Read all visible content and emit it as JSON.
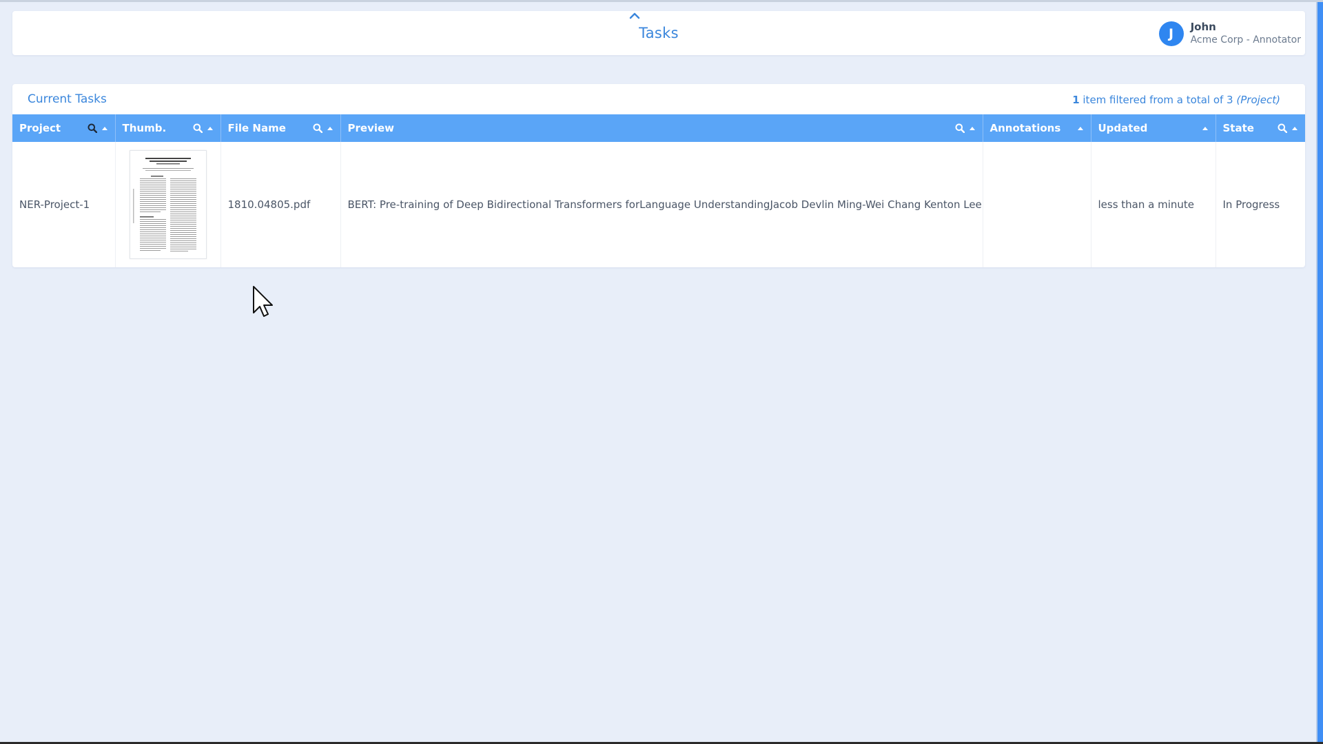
{
  "header": {
    "title": "Tasks",
    "user": {
      "initial": "J",
      "name": "John",
      "org": "Acme Corp - Annotator"
    }
  },
  "panel": {
    "title": "Current Tasks",
    "filter_count": "1",
    "filter_text": " item filtered from a total of 3 ",
    "filter_scope": "(Project)"
  },
  "table": {
    "columns": [
      {
        "label": "Project",
        "search": true,
        "sort": true
      },
      {
        "label": "Thumb.",
        "search": true,
        "sort": true
      },
      {
        "label": "File Name",
        "search": true,
        "sort": true
      },
      {
        "label": "Preview",
        "search": true,
        "sort": true
      },
      {
        "label": "Annotations",
        "search": false,
        "sort": true
      },
      {
        "label": "Updated",
        "search": false,
        "sort": true
      },
      {
        "label": "State",
        "search": true,
        "sort": true
      }
    ],
    "rows": [
      {
        "project": "NER-Project-1",
        "file_name": "1810.04805.pdf",
        "preview": "BERT: Pre-training of Deep Bidirectional Transformers forLanguage UnderstandingJacob Devlin Ming-Wei Chang Kenton Lee Kristina T",
        "annotations": "",
        "updated": "less than a minute",
        "state": "In Progress"
      }
    ]
  },
  "colors": {
    "accent": "#3a86dc",
    "header_bg": "#5aa5f7",
    "page_bg": "#e8eef9",
    "avatar_bg": "#2f86f0"
  }
}
